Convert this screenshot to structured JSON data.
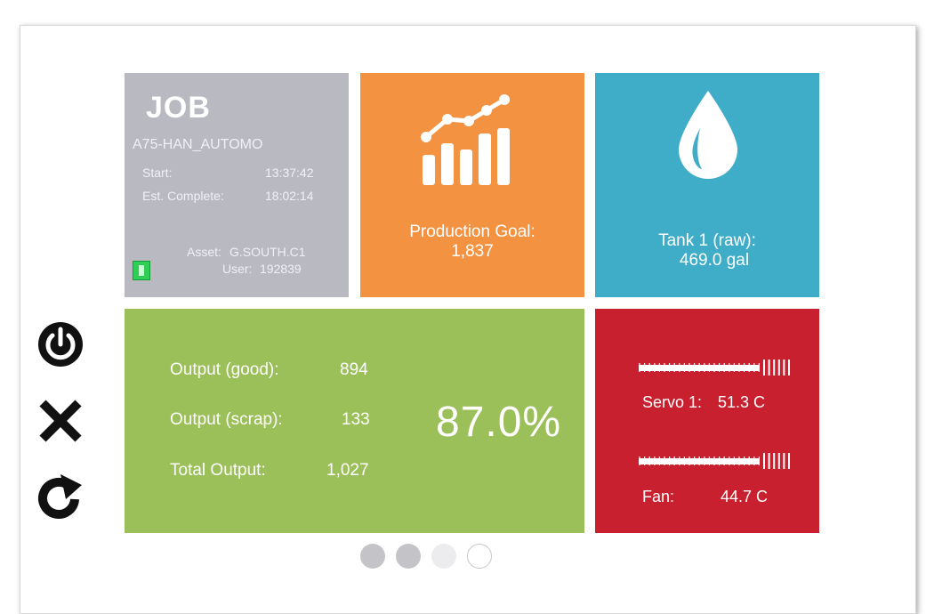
{
  "job": {
    "title": "JOB",
    "id": "A75-HAN_AUTOMO",
    "start_label": "Start:",
    "start_value": "13:37:42",
    "est_label": "Est. Complete:",
    "est_value": "18:02:14",
    "asset_label": "Asset:",
    "asset_value": "G.SOUTH.C1",
    "user_label": "User:",
    "user_value": "192839",
    "status_color": "#2fcf55"
  },
  "goal": {
    "label": "Production Goal:",
    "value": "1,837",
    "icon": "bar-chart-trend-icon",
    "color": "#f39240"
  },
  "tank": {
    "label": "Tank 1 (raw):",
    "value": "469.0 gal",
    "icon": "water-drop-icon",
    "color": "#3facc8"
  },
  "output": {
    "good_label": "Output (good):",
    "good_value": "894",
    "scrap_label": "Output (scrap):",
    "scrap_value": "133",
    "total_label": "Total Output:",
    "total_value": "1,027",
    "percent": "87.0%",
    "color": "#9bbf59"
  },
  "temps": {
    "color": "#c8202e",
    "servo_label": "Servo 1:",
    "servo_value": "51.3 C",
    "servo_level": 0.8,
    "fan_label": "Fan:",
    "fan_value": "44.7 C",
    "fan_level": 0.8
  },
  "side_buttons": [
    "power-icon",
    "close-icon",
    "refresh-icon"
  ],
  "pager": {
    "pages": 4,
    "current": 1
  }
}
